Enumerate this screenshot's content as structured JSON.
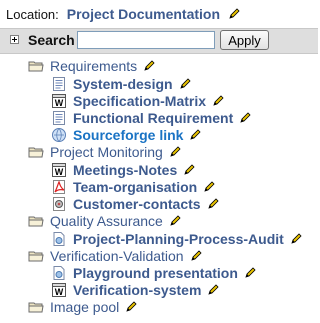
{
  "location": {
    "label": "Location:",
    "value": "Project Documentation",
    "edit_icon": "pencil-icon"
  },
  "search": {
    "label": "Search",
    "input_value": "",
    "button_label": "Apply"
  },
  "tree": [
    {
      "type": "folder",
      "label": "Requirements"
    },
    {
      "type": "doc",
      "icon": "document-icon",
      "label": "System-design"
    },
    {
      "type": "doc",
      "icon": "word-document-icon",
      "label": "Specification-Matrix"
    },
    {
      "type": "doc",
      "icon": "document-icon",
      "label": "Functional Requirement"
    },
    {
      "type": "link",
      "icon": "globe-link-icon",
      "label": "Sourceforge link"
    },
    {
      "type": "folder",
      "label": "Project Monitoring"
    },
    {
      "type": "doc",
      "icon": "word-document-icon",
      "label": "Meetings-Notes"
    },
    {
      "type": "doc",
      "icon": "pdf-document-icon",
      "label": "Team-organisation"
    },
    {
      "type": "doc",
      "icon": "contacts-file-icon",
      "label": "Customer-contacts"
    },
    {
      "type": "folder",
      "label": "Quality Assurance"
    },
    {
      "type": "doc",
      "icon": "image-document-icon",
      "label": "Project-Planning-Process-Audit"
    },
    {
      "type": "folder",
      "label": "Verification-Validation"
    },
    {
      "type": "doc",
      "icon": "image-document-icon",
      "label": "Playground presentation"
    },
    {
      "type": "doc",
      "icon": "word-document-icon",
      "label": "Verification-system"
    },
    {
      "type": "folder",
      "label": "Image pool"
    }
  ]
}
